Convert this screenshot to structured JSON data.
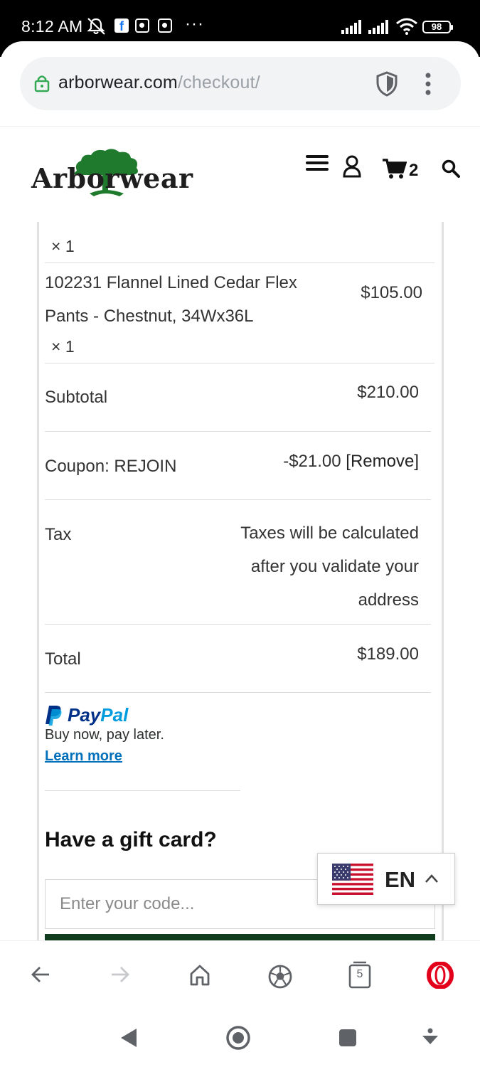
{
  "status_bar": {
    "time": "8:12 AM",
    "more": "···",
    "battery": "98",
    "icons": [
      "mute-icon",
      "facebook-icon",
      "video-icon",
      "video-icon",
      "signal-icon",
      "signal-icon",
      "wifi-icon",
      "battery-icon"
    ]
  },
  "browser": {
    "url_domain": "arborwear.com",
    "url_path": "/checkout/",
    "icons": [
      "lock-icon",
      "shield-icon",
      "menu-dots-icon"
    ]
  },
  "header": {
    "logo_text": "Arborwear",
    "cart_count": "2",
    "icons": [
      "hamburger-icon",
      "user-icon",
      "cart-icon",
      "search-icon"
    ]
  },
  "order": {
    "previous_item_qty": "× 1",
    "item": {
      "name": "102231 Flannel Lined Cedar Flex Pants - Chestnut, 34Wx36L",
      "qty": "× 1",
      "price": "$105.00"
    },
    "subtotal_label": "Subtotal",
    "subtotal_value": "$210.00",
    "coupon_label": "Coupon: REJOIN",
    "coupon_value": "-$21.00",
    "coupon_remove": "[Remove]",
    "tax_label": "Tax",
    "tax_note": "Taxes will be calculated after you validate your address",
    "total_label": "Total",
    "total_value": "$189.00"
  },
  "paypal": {
    "brand_pay": "Pay",
    "brand_pal": "Pal",
    "subtitle": "Buy now, pay later.",
    "learn_more": "Learn more",
    "colors": {
      "dark": "#003087",
      "light": "#009cde",
      "link": "#0070ba"
    }
  },
  "gift_card": {
    "title": "Have a gift card?",
    "placeholder": "Enter your code..."
  },
  "language": {
    "code": "EN",
    "icons": [
      "us-flag-icon",
      "chevron-up-icon"
    ]
  },
  "bottom_nav": {
    "tabs_count": "5",
    "icons": [
      "back-arrow-icon",
      "forward-arrow-icon",
      "home-icon",
      "soccer-ball-icon",
      "tabs-icon",
      "opera-icon"
    ]
  },
  "system_nav": {
    "icons": [
      "back-triangle-icon",
      "home-circle-icon",
      "recents-square-icon",
      "assistant-icon"
    ]
  },
  "colors": {
    "brand_green": "#1f7a2e",
    "dark_green_bar": "#0f3d1e",
    "opera_red": "#e3001b"
  }
}
